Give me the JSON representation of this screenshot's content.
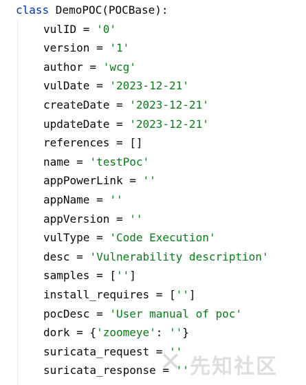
{
  "editor": {
    "class_def": {
      "keyword": "class",
      "rest": " DemoPOC(POCBase):"
    },
    "lines": [
      {
        "name": "vulID",
        "op": " = ",
        "value": "'0'",
        "value_type": "string"
      },
      {
        "name": "version",
        "op": " = ",
        "value": "'1'",
        "value_type": "string"
      },
      {
        "name": "author",
        "op": " = ",
        "value": "'wcg'",
        "value_type": "string"
      },
      {
        "name": "vulDate",
        "op": " = ",
        "value": "'2023-12-21'",
        "value_type": "string"
      },
      {
        "name": "createDate",
        "op": " = ",
        "value": "'2023-12-21'",
        "value_type": "string"
      },
      {
        "name": "updateDate",
        "op": " = ",
        "value": "'2023-12-21'",
        "value_type": "string"
      },
      {
        "name": "references",
        "op": " = ",
        "value": "[]",
        "value_type": "plain"
      },
      {
        "name": "name",
        "op": " = ",
        "value": "'testPoc'",
        "value_type": "string"
      },
      {
        "name": "appPowerLink",
        "op": " = ",
        "value": "''",
        "value_type": "string"
      },
      {
        "name": "appName",
        "op": " = ",
        "value": "''",
        "value_type": "string"
      },
      {
        "name": "appVersion",
        "op": " = ",
        "value": "''",
        "value_type": "string"
      },
      {
        "name": "vulType",
        "op": " = ",
        "value": "'Code Execution'",
        "value_type": "string"
      },
      {
        "name": "desc",
        "op": " = ",
        "value": "'Vulnerability description'",
        "value_type": "string"
      },
      {
        "name": "samples",
        "op": " = [",
        "value": "''",
        "value_type": "string",
        "suffix": "]"
      },
      {
        "name": "install_requires",
        "op": " = [",
        "value": "''",
        "value_type": "string",
        "suffix": "]"
      },
      {
        "name": "pocDesc",
        "op": " = ",
        "value": "'User manual of poc'",
        "value_type": "string"
      },
      {
        "name": "dork",
        "op": " = {",
        "value": "'zoomeye'",
        "value_type": "string",
        "mid": ": ",
        "value2": "''",
        "suffix": "}"
      },
      {
        "name": "suricata_request",
        "op": " = ",
        "value": "''",
        "value_type": "string"
      },
      {
        "name": "suricata_response",
        "op": " = ",
        "value": "''",
        "value_type": "string"
      }
    ]
  },
  "watermark": {
    "text": "先知社区",
    "mark": "✕"
  },
  "colors": {
    "keyword": "#0033b3",
    "string": "#067d17",
    "text": "#080808"
  }
}
